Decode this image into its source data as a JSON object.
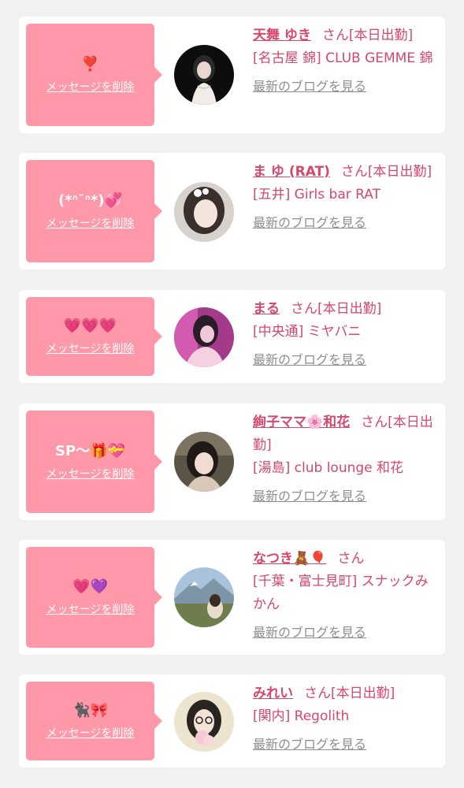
{
  "entries": [
    {
      "message": "❣️",
      "delete_label": "メッセージを削除",
      "name": "天舞 ゆき",
      "honorific": "さん",
      "status": "[本日出勤]",
      "shop": "[名古屋 錦] CLUB GEMME 錦",
      "blog_label": "最新のブログを見る"
    },
    {
      "message": "(*ᐢ˘ᐢ*)💞",
      "delete_label": "メッセージを削除",
      "name": "ま ゆ (RAT)",
      "honorific": "さん",
      "status": "[本日出勤]",
      "shop": "[五井] Girls bar RAT",
      "blog_label": "最新のブログを見る"
    },
    {
      "message": "💗💗💗",
      "delete_label": "メッセージを削除",
      "name": "まる",
      "honorific": "さん",
      "status": "[本日出勤]",
      "shop": "[中央通] ミヤバニ",
      "blog_label": "最新のブログを見る"
    },
    {
      "message": "SP〜🎁💝",
      "delete_label": "メッセージを削除",
      "name": "絢子ママ🌸和花",
      "honorific": "さん",
      "status": "[本日出勤]",
      "shop": "[湯島] club lounge 和花",
      "blog_label": "最新のブログを見る"
    },
    {
      "message": "💗💜",
      "delete_label": "メッセージを削除",
      "name": "なつき🧸🎈",
      "honorific": "さん",
      "status": "",
      "shop": "[千葉・富士見町] スナックみかん",
      "blog_label": "最新のブログを見る"
    },
    {
      "message": "🐈‍⬛🎀",
      "delete_label": "メッセージを削除",
      "name": "みれい",
      "honorific": "さん",
      "status": "[本日出勤]",
      "shop": "[関内] Regolith",
      "blog_label": "最新のブログを見る"
    }
  ]
}
